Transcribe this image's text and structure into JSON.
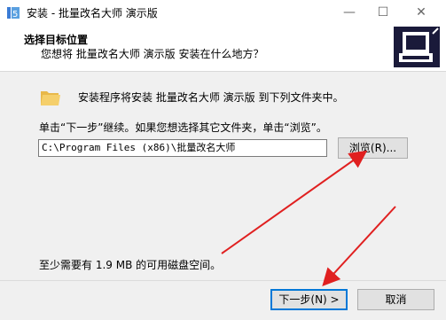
{
  "window": {
    "title": "安装 - 批量改名大师 演示版"
  },
  "header": {
    "title": "选择目标位置",
    "subtitle": "您想将 批量改名大师 演示版 安装在什么地方？"
  },
  "body": {
    "install_to_text": "安装程序将安装 批量改名大师 演示版 到下列文件夹中。",
    "click_next_text": "单击“下一步”继续。如果您想选择其它文件夹，单击“浏览”。",
    "path_value": "C:\\Program Files (x86)\\批量改名大师",
    "browse_label": "浏览(R)...",
    "space_text": "至少需要有 1.9 MB 的可用磁盘空间。"
  },
  "footer": {
    "next_label": "下一步(N) >",
    "cancel_label": "取消"
  },
  "icons": [
    "app-installer-icon",
    "minimize-icon",
    "maximize-icon",
    "close-icon",
    "setup-computer-icon",
    "folder-icon"
  ],
  "colors": {
    "accent": "#0078d7",
    "arrow": "#e02020"
  }
}
